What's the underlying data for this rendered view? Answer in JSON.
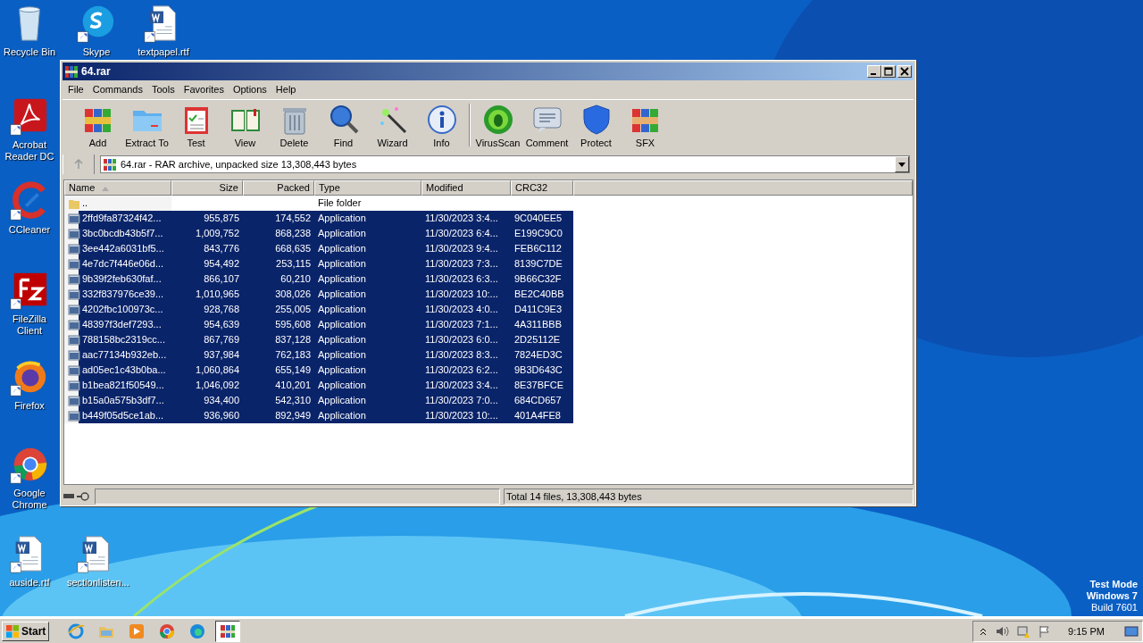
{
  "desktop_icons": [
    {
      "label": "Recycle Bin",
      "kind": "recycle"
    },
    {
      "label": "Skype",
      "kind": "skype"
    },
    {
      "label": "textpapel.rtf",
      "kind": "doc"
    },
    {
      "label": "Acrobat Reader DC",
      "kind": "acrobat"
    },
    {
      "label": "CCleaner",
      "kind": "ccleaner"
    },
    {
      "label": "FileZilla Client",
      "kind": "filezilla"
    },
    {
      "label": "Firefox",
      "kind": "firefox"
    },
    {
      "label": "Google Chrome",
      "kind": "chrome"
    },
    {
      "label": "auside.rtf",
      "kind": "doc"
    },
    {
      "label": "sectionlisten...",
      "kind": "doc"
    }
  ],
  "window": {
    "title": "64.rar",
    "menu": [
      "File",
      "Commands",
      "Tools",
      "Favorites",
      "Options",
      "Help"
    ],
    "toolbar": [
      {
        "label": "Add",
        "kind": "add"
      },
      {
        "label": "Extract To",
        "kind": "extract"
      },
      {
        "label": "Test",
        "kind": "test"
      },
      {
        "label": "View",
        "kind": "view"
      },
      {
        "label": "Delete",
        "kind": "delete"
      },
      {
        "label": "Find",
        "kind": "find"
      },
      {
        "label": "Wizard",
        "kind": "wizard"
      },
      {
        "label": "Info",
        "kind": "info"
      },
      {
        "label": "VirusScan",
        "kind": "virus"
      },
      {
        "label": "Comment",
        "kind": "comment"
      },
      {
        "label": "Protect",
        "kind": "protect"
      },
      {
        "label": "SFX",
        "kind": "sfx"
      }
    ],
    "path": "64.rar - RAR archive, unpacked size 13,308,443 bytes",
    "table": {
      "columns": [
        "Name",
        "Size",
        "Packed",
        "Type",
        "Modified",
        "CRC32"
      ],
      "rows": [
        {
          "kind": "folder",
          "selected": false,
          "cells": [
            "..",
            "",
            "",
            "File folder",
            "",
            ""
          ]
        },
        {
          "kind": "file",
          "selected": true,
          "cells": [
            "2ffd9fa87324f42...",
            "955,875",
            "174,552",
            "Application",
            "11/30/2023 3:4...",
            "9C040EE5"
          ]
        },
        {
          "kind": "file",
          "selected": true,
          "cells": [
            "3bc0bcdb43b5f7...",
            "1,009,752",
            "868,238",
            "Application",
            "11/30/2023 6:4...",
            "E199C9C0"
          ]
        },
        {
          "kind": "file",
          "selected": true,
          "cells": [
            "3ee442a6031bf5...",
            "843,776",
            "668,635",
            "Application",
            "11/30/2023 9:4...",
            "FEB6C112"
          ]
        },
        {
          "kind": "file",
          "selected": true,
          "cells": [
            "4e7dc7f446e06d...",
            "954,492",
            "253,115",
            "Application",
            "11/30/2023 7:3...",
            "8139C7DE"
          ]
        },
        {
          "kind": "file",
          "selected": true,
          "cells": [
            "9b39f2feb630faf...",
            "866,107",
            "60,210",
            "Application",
            "11/30/2023 6:3...",
            "9B66C32F"
          ]
        },
        {
          "kind": "file",
          "selected": true,
          "cells": [
            "332f837976ce39...",
            "1,010,965",
            "308,026",
            "Application",
            "11/30/2023 10:...",
            "BE2C40BB"
          ]
        },
        {
          "kind": "file",
          "selected": true,
          "cells": [
            "4202fbc100973c...",
            "928,768",
            "255,005",
            "Application",
            "11/30/2023 4:0...",
            "D411C9E3"
          ]
        },
        {
          "kind": "file",
          "selected": true,
          "cells": [
            "48397f3def7293...",
            "954,639",
            "595,608",
            "Application",
            "11/30/2023 7:1...",
            "4A311BBB"
          ]
        },
        {
          "kind": "file",
          "selected": true,
          "cells": [
            "788158bc2319cc...",
            "867,769",
            "837,128",
            "Application",
            "11/30/2023 6:0...",
            "2D25112E"
          ]
        },
        {
          "kind": "file",
          "selected": true,
          "cells": [
            "aac77134b932eb...",
            "937,984",
            "762,183",
            "Application",
            "11/30/2023 8:3...",
            "7824ED3C"
          ]
        },
        {
          "kind": "file",
          "selected": true,
          "cells": [
            "ad05ec1c43b0ba...",
            "1,060,864",
            "655,149",
            "Application",
            "11/30/2023 6:2...",
            "9B3D643C"
          ]
        },
        {
          "kind": "file",
          "selected": true,
          "cells": [
            "b1bea821f50549...",
            "1,046,092",
            "410,201",
            "Application",
            "11/30/2023 3:4...",
            "8E37BFCE"
          ]
        },
        {
          "kind": "file",
          "selected": true,
          "cells": [
            "b15a0a575b3df7...",
            "934,400",
            "542,310",
            "Application",
            "11/30/2023 7:0...",
            "684CD657"
          ]
        },
        {
          "kind": "file",
          "selected": true,
          "cells": [
            "b449f05d5ce1ab...",
            "936,960",
            "892,949",
            "Application",
            "11/30/2023 10:...",
            "401A4FE8"
          ]
        }
      ]
    },
    "status": "Total 14 files, 13,308,443 bytes"
  },
  "os_notice": [
    "Test Mode",
    "Windows 7",
    "Build 7601"
  ],
  "taskbar": {
    "start": "Start",
    "apps": [
      {
        "kind": "ie",
        "selected": false
      },
      {
        "kind": "explorer",
        "selected": false
      },
      {
        "kind": "media",
        "selected": false
      },
      {
        "kind": "chrome",
        "selected": false
      },
      {
        "kind": "edge",
        "selected": false
      },
      {
        "kind": "winrar",
        "selected": true
      }
    ],
    "clock": "9:15 PM"
  }
}
